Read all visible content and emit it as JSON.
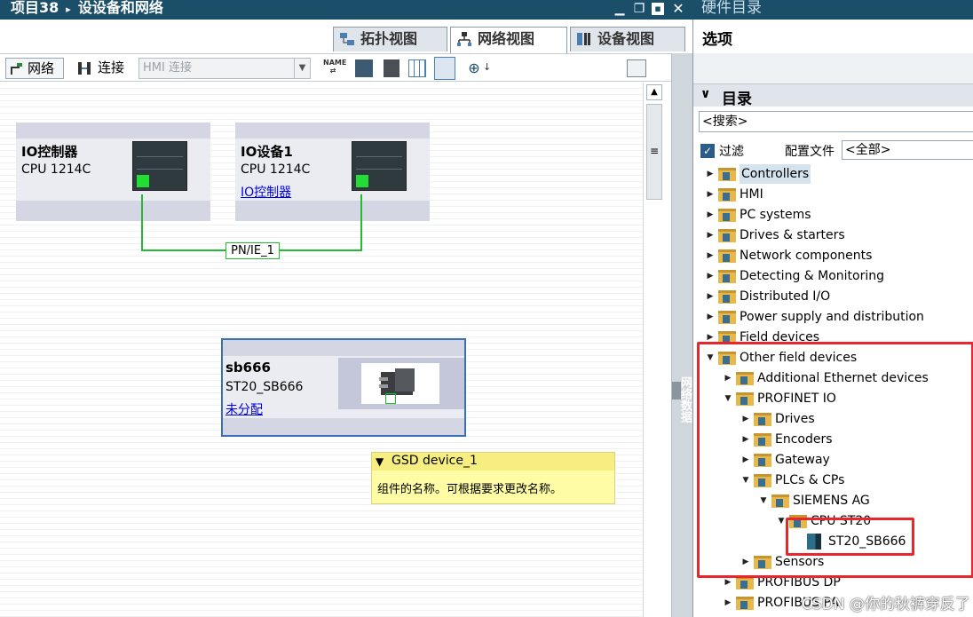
{
  "window": {
    "breadcrumb_project": "项目38",
    "breadcrumb_sep": "▸",
    "breadcrumb_page": "设设备和网络",
    "right_panel_title": "硬件目录"
  },
  "view_tabs": [
    {
      "label": "拓扑视图",
      "active": false
    },
    {
      "label": "网络视图",
      "active": true
    },
    {
      "label": "设备视图",
      "active": false
    }
  ],
  "toolbar": {
    "network_label": "网络",
    "connect_label": "连接",
    "connection_type_value": "HMI 连接"
  },
  "devices": [
    {
      "name": "IO控制器",
      "type": "CPU 1214C",
      "link": ""
    },
    {
      "name": "IO设备1",
      "type": "CPU 1214C",
      "link": "IO控制器"
    },
    {
      "name": "sb666",
      "type": "ST20_SB666",
      "link": "未分配"
    }
  ],
  "network_label": "PN/IE_1",
  "tooltip": {
    "title": "GSD device_1",
    "text": "组件的名称。可根据要求更改名称。"
  },
  "sidebar_vertical_label": "网络数据",
  "catalog": {
    "options_label": "选项",
    "section_label": "目录",
    "search_value": "<搜索>",
    "filter_label": "过滤",
    "filter_checked": true,
    "profile_label": "配置文件",
    "profile_value": "<全部>",
    "items": [
      {
        "label": "Controllers",
        "indent": 0,
        "expanded": false,
        "selected": true
      },
      {
        "label": "HMI",
        "indent": 0,
        "expanded": false,
        "selected": false
      },
      {
        "label": "PC systems",
        "indent": 0,
        "expanded": false,
        "selected": false
      },
      {
        "label": "Drives & starters",
        "indent": 0,
        "expanded": false,
        "selected": false
      },
      {
        "label": "Network components",
        "indent": 0,
        "expanded": false,
        "selected": false
      },
      {
        "label": "Detecting & Monitoring",
        "indent": 0,
        "expanded": false,
        "selected": false
      },
      {
        "label": "Distributed I/O",
        "indent": 0,
        "expanded": false,
        "selected": false
      },
      {
        "label": "Power supply and distribution",
        "indent": 0,
        "expanded": false,
        "selected": false
      },
      {
        "label": "Field devices",
        "indent": 0,
        "expanded": false,
        "selected": false
      },
      {
        "label": "Other field devices",
        "indent": 0,
        "expanded": true,
        "selected": false
      },
      {
        "label": "Additional Ethernet devices",
        "indent": 1,
        "expanded": false,
        "selected": false
      },
      {
        "label": "PROFINET IO",
        "indent": 1,
        "expanded": true,
        "selected": false
      },
      {
        "label": "Drives",
        "indent": 2,
        "expanded": false,
        "selected": false
      },
      {
        "label": "Encoders",
        "indent": 2,
        "expanded": false,
        "selected": false
      },
      {
        "label": "Gateway",
        "indent": 2,
        "expanded": false,
        "selected": false
      },
      {
        "label": "PLCs & CPs",
        "indent": 2,
        "expanded": true,
        "selected": false
      },
      {
        "label": "SIEMENS AG",
        "indent": 3,
        "expanded": true,
        "selected": false
      },
      {
        "label": "CPU ST20",
        "indent": 4,
        "expanded": true,
        "selected": false
      },
      {
        "label": "ST20_SB666",
        "indent": 5,
        "expanded": null,
        "selected": false
      },
      {
        "label": "Sensors",
        "indent": 2,
        "expanded": false,
        "selected": false
      },
      {
        "label": "PROFIBUS DP",
        "indent": 1,
        "expanded": false,
        "selected": false
      },
      {
        "label": "PROFIBUS PA",
        "indent": 1,
        "expanded": false,
        "selected": false
      }
    ]
  },
  "watermark": "CSDN @你的秋裤穿反了"
}
